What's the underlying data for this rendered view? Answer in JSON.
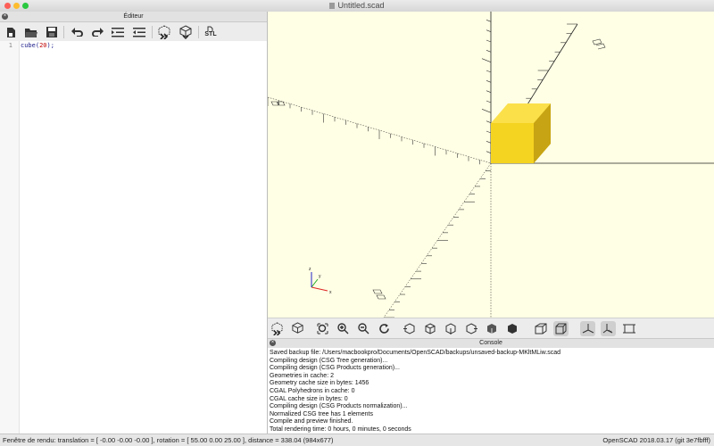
{
  "window": {
    "title": "Untitled.scad"
  },
  "editor": {
    "header": "Éditeur",
    "toolbar": [
      "new-file-icon",
      "open-file-icon",
      "save-icon",
      "undo-icon",
      "redo-icon",
      "indent-icon",
      "unindent-icon",
      "preview-icon",
      "render-icon",
      "export-stl-icon"
    ],
    "stl_label": "STL",
    "line_number": "1",
    "code_prefix": "cube(",
    "code_number": "20",
    "code_suffix": ");"
  },
  "viewport": {
    "cube_color": "#f5d321",
    "axis_labels": {
      "x": "x",
      "y": "y",
      "z": "z"
    }
  },
  "view_toolbar": {
    "buttons": [
      "preview-icon",
      "render-icon",
      "view-all-icon",
      "zoom-in-icon",
      "zoom-out-icon",
      "reset-view-icon",
      "view-right-icon",
      "view-top-icon",
      "view-bottom-icon",
      "view-left-icon",
      "view-front-icon",
      "view-back-icon",
      "perspective-icon",
      "orthogonal-icon",
      "show-axes-icon",
      "show-scale-markers-icon",
      "show-edges-icon"
    ]
  },
  "console": {
    "header": "Console",
    "lines": [
      "Saved backup file: /Users/macbookpro/Documents/OpenSCAD/backups/unsaved-backup-MKltMLiw.scad",
      "Compiling design (CSG Tree generation)...",
      "Compiling design (CSG Products generation)...",
      "Geometries in cache: 2",
      "Geometry cache size in bytes: 1456",
      "CGAL Polyhedrons in cache: 0",
      "CGAL cache size in bytes: 0",
      "Compiling design (CSG Products normalization)...",
      "Normalized CSG tree has 1 elements",
      "Compile and preview finished.",
      "Total rendering time: 0 hours, 0 minutes, 0 seconds"
    ]
  },
  "status": {
    "left": "Fenêtre de rendu: translation = [ -0.00 -0.00 -0.00 ], rotation = [ 55.00 0.00 25.00 ], distance = 338.04 (984x677)",
    "right": "OpenSCAD 2018.03.17 (git 3e7fbfff)"
  }
}
